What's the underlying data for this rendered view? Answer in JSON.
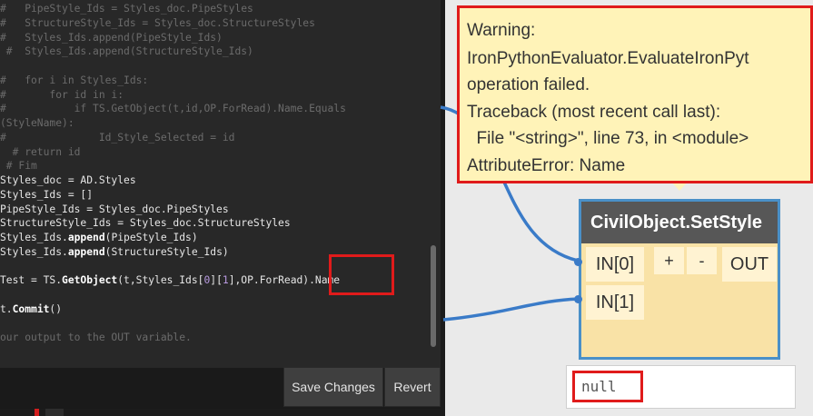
{
  "editor": {
    "lines": [
      {
        "text": "#   PipeStyle_Ids = Styles_doc.PipeStyles",
        "kind": "comment"
      },
      {
        "text": "#   StructureStyle_Ids = Styles_doc.StructureStyles",
        "kind": "comment"
      },
      {
        "text": "#   Styles_Ids.append(PipeStyle_Ids)",
        "kind": "comment"
      },
      {
        "text": " #  Styles_Ids.append(StructureStyle_Ids)",
        "kind": "comment"
      },
      {
        "text": "",
        "kind": "comment"
      },
      {
        "text": "#   for i in Styles_Ids:",
        "kind": "comment"
      },
      {
        "text": "#       for id in i:",
        "kind": "comment"
      },
      {
        "text": "#           if TS.GetObject(t,id,OP.ForRead).Name.Equals",
        "kind": "comment"
      },
      {
        "text": "(StyleName):",
        "kind": "comment"
      },
      {
        "text": "#               Id_Style_Selected = id",
        "kind": "comment"
      },
      {
        "text": "  # return id",
        "kind": "comment"
      },
      {
        "text": " # Fim",
        "kind": "comment"
      },
      {
        "text": "Styles_doc = AD.Styles",
        "kind": "code"
      },
      {
        "text": "Styles_Ids = []",
        "kind": "code"
      },
      {
        "text": "PipeStyle_Ids = Styles_doc.PipeStyles",
        "kind": "code"
      },
      {
        "text": "StructureStyle_Ids = Styles_doc.StructureStyles",
        "kind": "code"
      },
      {
        "text": "Styles_Ids.append(PipeStyle_Ids)",
        "kind": "code"
      },
      {
        "text": "Styles_Ids.append(StructureStyle_Ids)",
        "kind": "code"
      },
      {
        "text": "",
        "kind": "code"
      },
      {
        "text": "Test = TS.GetObject(t,Styles_Ids[0][1],OP.ForRead).Name",
        "kind": "code"
      },
      {
        "text": "",
        "kind": "code"
      },
      {
        "text": "t.Commit()",
        "kind": "code"
      },
      {
        "text": "",
        "kind": "code"
      },
      {
        "text": "our output to the OUT variable.",
        "kind": "comment"
      }
    ]
  },
  "toolbar": {
    "save_label": "Save Changes",
    "revert_label": "Revert"
  },
  "warning": {
    "lines": [
      "Warning:",
      "IronPythonEvaluator.EvaluateIronPyt",
      "operation failed.",
      "Traceback (most recent call last):",
      "  File \"<string>\", line 73, in <module>",
      "AttributeError: Name"
    ]
  },
  "node": {
    "title": "CivilObject.SetStyle",
    "inputs": [
      "IN[0]",
      "IN[1]"
    ],
    "add_label": "+",
    "remove_label": "-",
    "output": "OUT"
  },
  "preview": {
    "value": "null"
  },
  "colors": {
    "editor_bg": "#282828",
    "comment": "#6b6b6b",
    "code": "#e6e6e6",
    "warning_bg": "#fff3b8",
    "node_bg": "#f9e2a6",
    "node_header": "#575757",
    "wire": "#3a7bc8",
    "highlight": "#e01b1b"
  }
}
